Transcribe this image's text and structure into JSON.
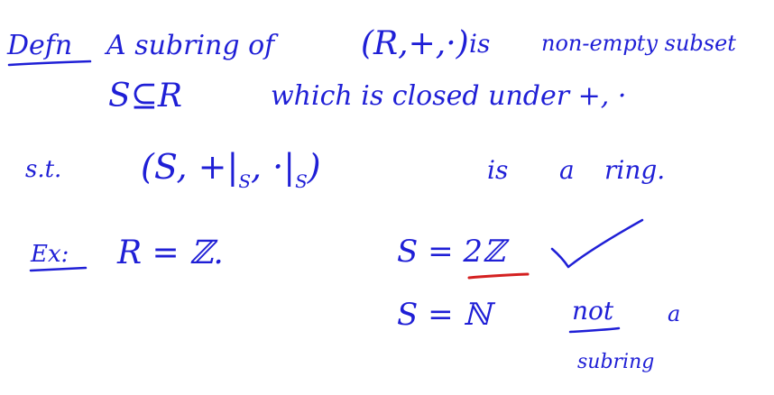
{
  "colors": {
    "ink": "#1f1fd6",
    "underline_red": "#d42020",
    "background": "#ffffff"
  },
  "note": {
    "line1": {
      "label": "Defn",
      "text_a": "A subring of",
      "text_b": "(R,+,·)",
      "text_c": "is",
      "text_d": "non-empty subset"
    },
    "line2": {
      "text_a": "S⊆R",
      "text_b": "which is closed under +, ·"
    },
    "line3": {
      "text_a": "s.t.",
      "text_b": "(S, +|",
      "sub_b": "S",
      "text_c": ", ·|",
      "sub_c": "S",
      "text_d": ")",
      "text_e": "is",
      "text_f": "a",
      "text_g": "ring."
    },
    "example": {
      "label": "Ex:",
      "ring_def": "R = ℤ.",
      "case1": "S = 2ℤ",
      "case1_mark": "check-mark-icon",
      "case2": "S = ℕ",
      "case2_verdict_a": "not",
      "case2_verdict_b": "a",
      "case2_verdict_c": "subring"
    }
  }
}
